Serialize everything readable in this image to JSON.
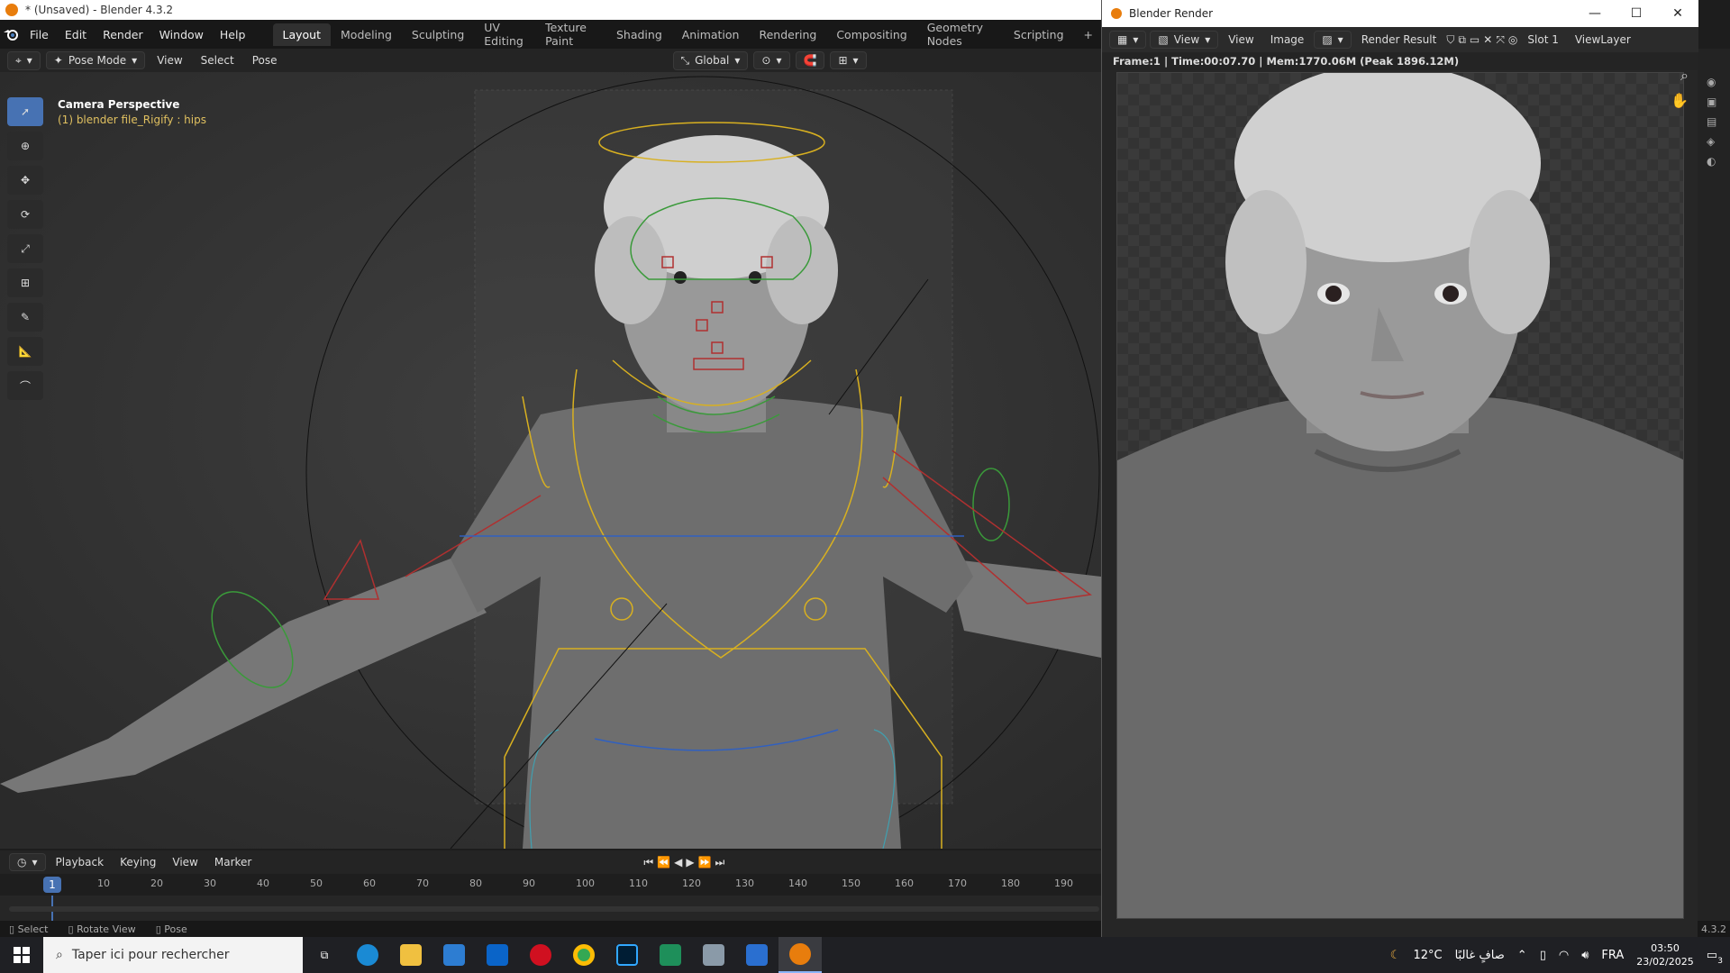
{
  "main_window": {
    "title": "* (Unsaved) - Blender 4.3.2"
  },
  "menubar": {
    "menus": [
      "File",
      "Edit",
      "Render",
      "Window",
      "Help"
    ],
    "workspaces": [
      "Layout",
      "Modeling",
      "Sculpting",
      "UV Editing",
      "Texture Paint",
      "Shading",
      "Animation",
      "Rendering",
      "Compositing",
      "Geometry Nodes",
      "Scripting"
    ],
    "active_workspace": "Layout",
    "add_label": "+"
  },
  "viewport_header": {
    "mode": "Pose Mode",
    "menus": [
      "View",
      "Select",
      "Pose"
    ],
    "orientation": "Global"
  },
  "viewport": {
    "camera_label": "Camera Perspective",
    "object_label": "(1) blender file_Rigify : hips"
  },
  "timeline": {
    "menus": [
      "Playback",
      "Keying",
      "View",
      "Marker"
    ],
    "current_frame": "1",
    "ticks": [
      "10",
      "20",
      "30",
      "40",
      "50",
      "60",
      "70",
      "80",
      "90",
      "100",
      "110",
      "120",
      "130",
      "140",
      "150",
      "160",
      "170",
      "180",
      "190"
    ]
  },
  "statusbar": {
    "items": [
      "Select",
      "Rotate View",
      "Pose"
    ],
    "version_fragment": "4.3.2"
  },
  "render_window": {
    "title": "Blender Render",
    "menus": [
      "View",
      "View",
      "Image"
    ],
    "image_name": "Render Result",
    "slot": "Slot 1",
    "view_layer": "ViewLayer",
    "info": "Frame:1 | Time:00:07.70 | Mem:1770.06M (Peak 1896.12M)"
  },
  "taskbar": {
    "search_placeholder": "Taper ici pour rechercher",
    "weather_temp": "12°C",
    "weather_text": "صافٍ غالبًا",
    "language": "FRA",
    "time": "03:50",
    "date": "23/02/2025",
    "notification_count": "3"
  },
  "colors": {
    "accent_blue": "#4772b3",
    "blender_orange": "#e87d0d",
    "rig_yellow": "#d8b020",
    "rig_red": "#b03030",
    "rig_green": "#3a9a3a"
  }
}
